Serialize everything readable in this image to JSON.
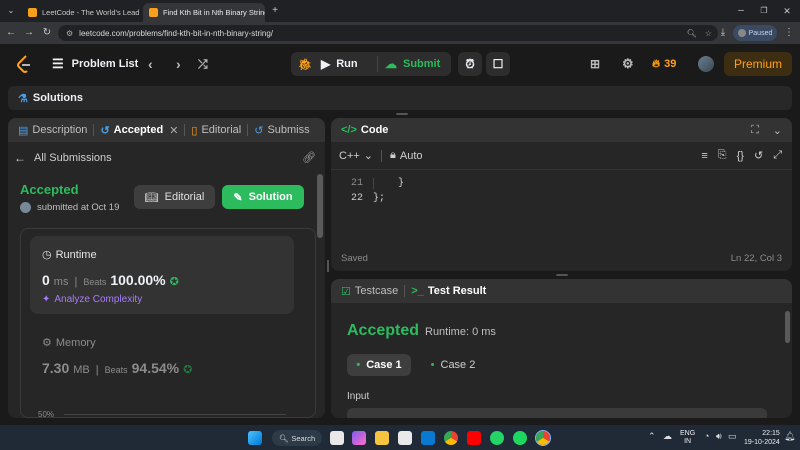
{
  "browser": {
    "tabs": [
      {
        "title": "LeetCode - The World's Leadin",
        "active": false
      },
      {
        "title": "Find Kth Bit in Nth Binary String",
        "active": true
      }
    ],
    "url": "leetcode.com/problems/find-kth-bit-in-nth-binary-string/",
    "profile_status": "Paused"
  },
  "header": {
    "problem_list": "Problem List",
    "run": "Run",
    "submit": "Submit",
    "streak": "39",
    "premium": "Premium"
  },
  "solutions_bar": {
    "label": "Solutions"
  },
  "left_panel": {
    "tabs": [
      "Description",
      "Accepted",
      "Editorial",
      "Submiss"
    ],
    "all_submissions": "All Submissions",
    "status": "Accepted",
    "submitted": "submitted at Oct 19",
    "editorial_button": "Editorial",
    "solution_button": "Solution",
    "runtime": {
      "title": "Runtime",
      "value": "0",
      "unit": "ms",
      "beats_label": "Beats",
      "beats": "100.00%",
      "analyze": "Analyze Complexity"
    },
    "memory": {
      "title": "Memory",
      "value": "7.30",
      "unit": "MB",
      "beats_label": "Beats",
      "beats": "94.54%"
    },
    "chart_tick": "50%"
  },
  "code_panel": {
    "title": "Code",
    "language": "C++",
    "mode": "Auto",
    "lines": [
      {
        "num": "21",
        "text": "    }"
      },
      {
        "num": "22",
        "text": "};"
      }
    ],
    "saved": "Saved",
    "cursor": "Ln 22, Col 3"
  },
  "test_panel": {
    "testcase_tab": "Testcase",
    "result_tab": "Test Result",
    "status": "Accepted",
    "runtime": "Runtime: 0 ms",
    "cases": [
      "Case 1",
      "Case 2"
    ],
    "input_label": "Input"
  },
  "taskbar": {
    "search": "Search",
    "lang_line1": "ENG",
    "lang_line2": "IN",
    "time": "22:15",
    "date": "19-10-2024"
  },
  "colors": {
    "accent_green": "#2cbb5d",
    "brand_orange": "#ffa116",
    "code_blue": "#4c9ee6",
    "analyze_purple": "#a67cf7"
  }
}
